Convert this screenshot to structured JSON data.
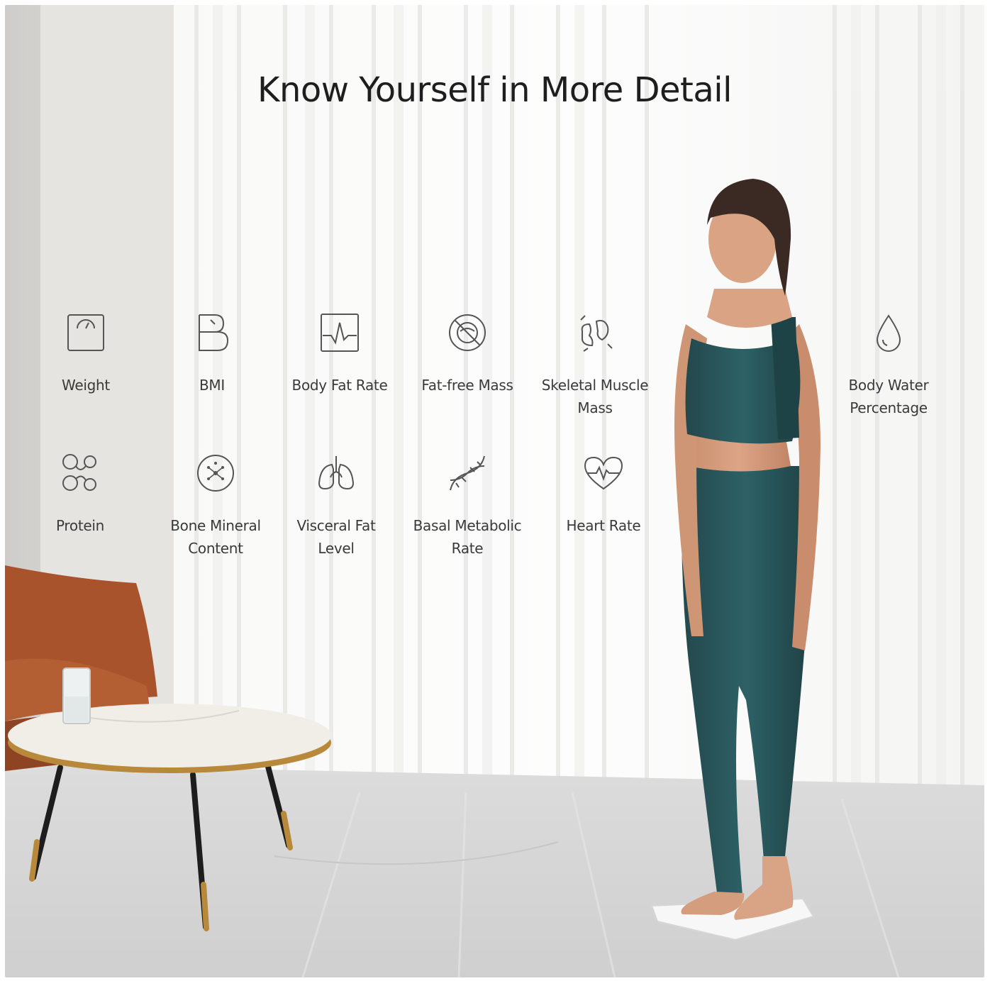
{
  "headline": "Know Yourself in More Detail",
  "metrics": [
    {
      "label": "Weight",
      "icon": "weight-scale-icon"
    },
    {
      "label": "BMI",
      "icon": "bmi-icon"
    },
    {
      "label": "Body Fat Rate",
      "icon": "body-fat-chart-icon"
    },
    {
      "label": "Fat-free Mass",
      "icon": "fat-free-mass-icon"
    },
    {
      "label": "Skeletal Muscle\nMass",
      "icon": "muscle-icon"
    },
    {
      "label": "Body Water\nPercentage",
      "icon": "water-drop-icon"
    },
    {
      "label": "Protein",
      "icon": "protein-icon"
    },
    {
      "label": "Bone Mineral\nContent",
      "icon": "bone-mineral-icon"
    },
    {
      "label": "Visceral Fat\nLevel",
      "icon": "lungs-icon"
    },
    {
      "label": "Basal Metabolic\nRate",
      "icon": "dna-icon"
    },
    {
      "label": "Heart Rate",
      "icon": "heart-rate-icon"
    }
  ],
  "colors": {
    "outfit": "#2d6166",
    "chair": "#a8532c",
    "icon_stroke": "#555555",
    "headline": "#1e1e1e"
  }
}
